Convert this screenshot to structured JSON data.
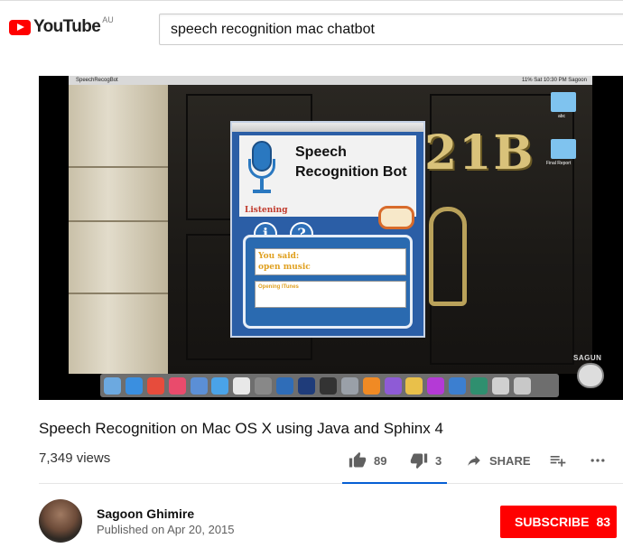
{
  "header": {
    "logo_text": "YouTube",
    "region": "AU",
    "search_query": "speech recognition mac chatbot"
  },
  "video": {
    "mac_menubar": {
      "app_name": "SpeechRecogBot",
      "status": "11% Sat 10:30 PM Sagoon"
    },
    "desktop": {
      "door_number": "21B",
      "folders": [
        "abc",
        "Final Report"
      ],
      "watermark": "SAGUN"
    },
    "app_window": {
      "title": "Speech Recognition Bot",
      "status": "Listening",
      "info_button": "i",
      "help_button": "?",
      "you_said_label": "You said:",
      "you_said_text": "open music",
      "reply_text": "Opening ITunes"
    },
    "dock_icon_colors": [
      "#6ca9e0",
      "#3a8fe0",
      "#e74c3c",
      "#e94b6c",
      "#5b8fd6",
      "#4aa3e8",
      "#e8e8e8",
      "#888888",
      "#2f6db8",
      "#1f3c7a",
      "#333333",
      "#9aa0a8",
      "#f08a24",
      "#8e5bd6",
      "#e9c04a",
      "#b43ad6",
      "#3c7fd0",
      "#2f8f6f",
      "#d0d0d0",
      "#c8c8c8"
    ]
  },
  "meta": {
    "title": "Speech Recognition on Mac OS X using Java and Sphinx 4",
    "views": "7,349 views",
    "likes": "89",
    "dislikes": "3",
    "share_label": "SHARE"
  },
  "channel": {
    "name": "Sagoon Ghimire",
    "published": "Published on Apr 20, 2015",
    "subscribe_label": "SUBSCRIBE",
    "subscriber_count": "83"
  },
  "colors": {
    "brand_red": "#ff0000",
    "accent_blue": "#065fd4"
  }
}
